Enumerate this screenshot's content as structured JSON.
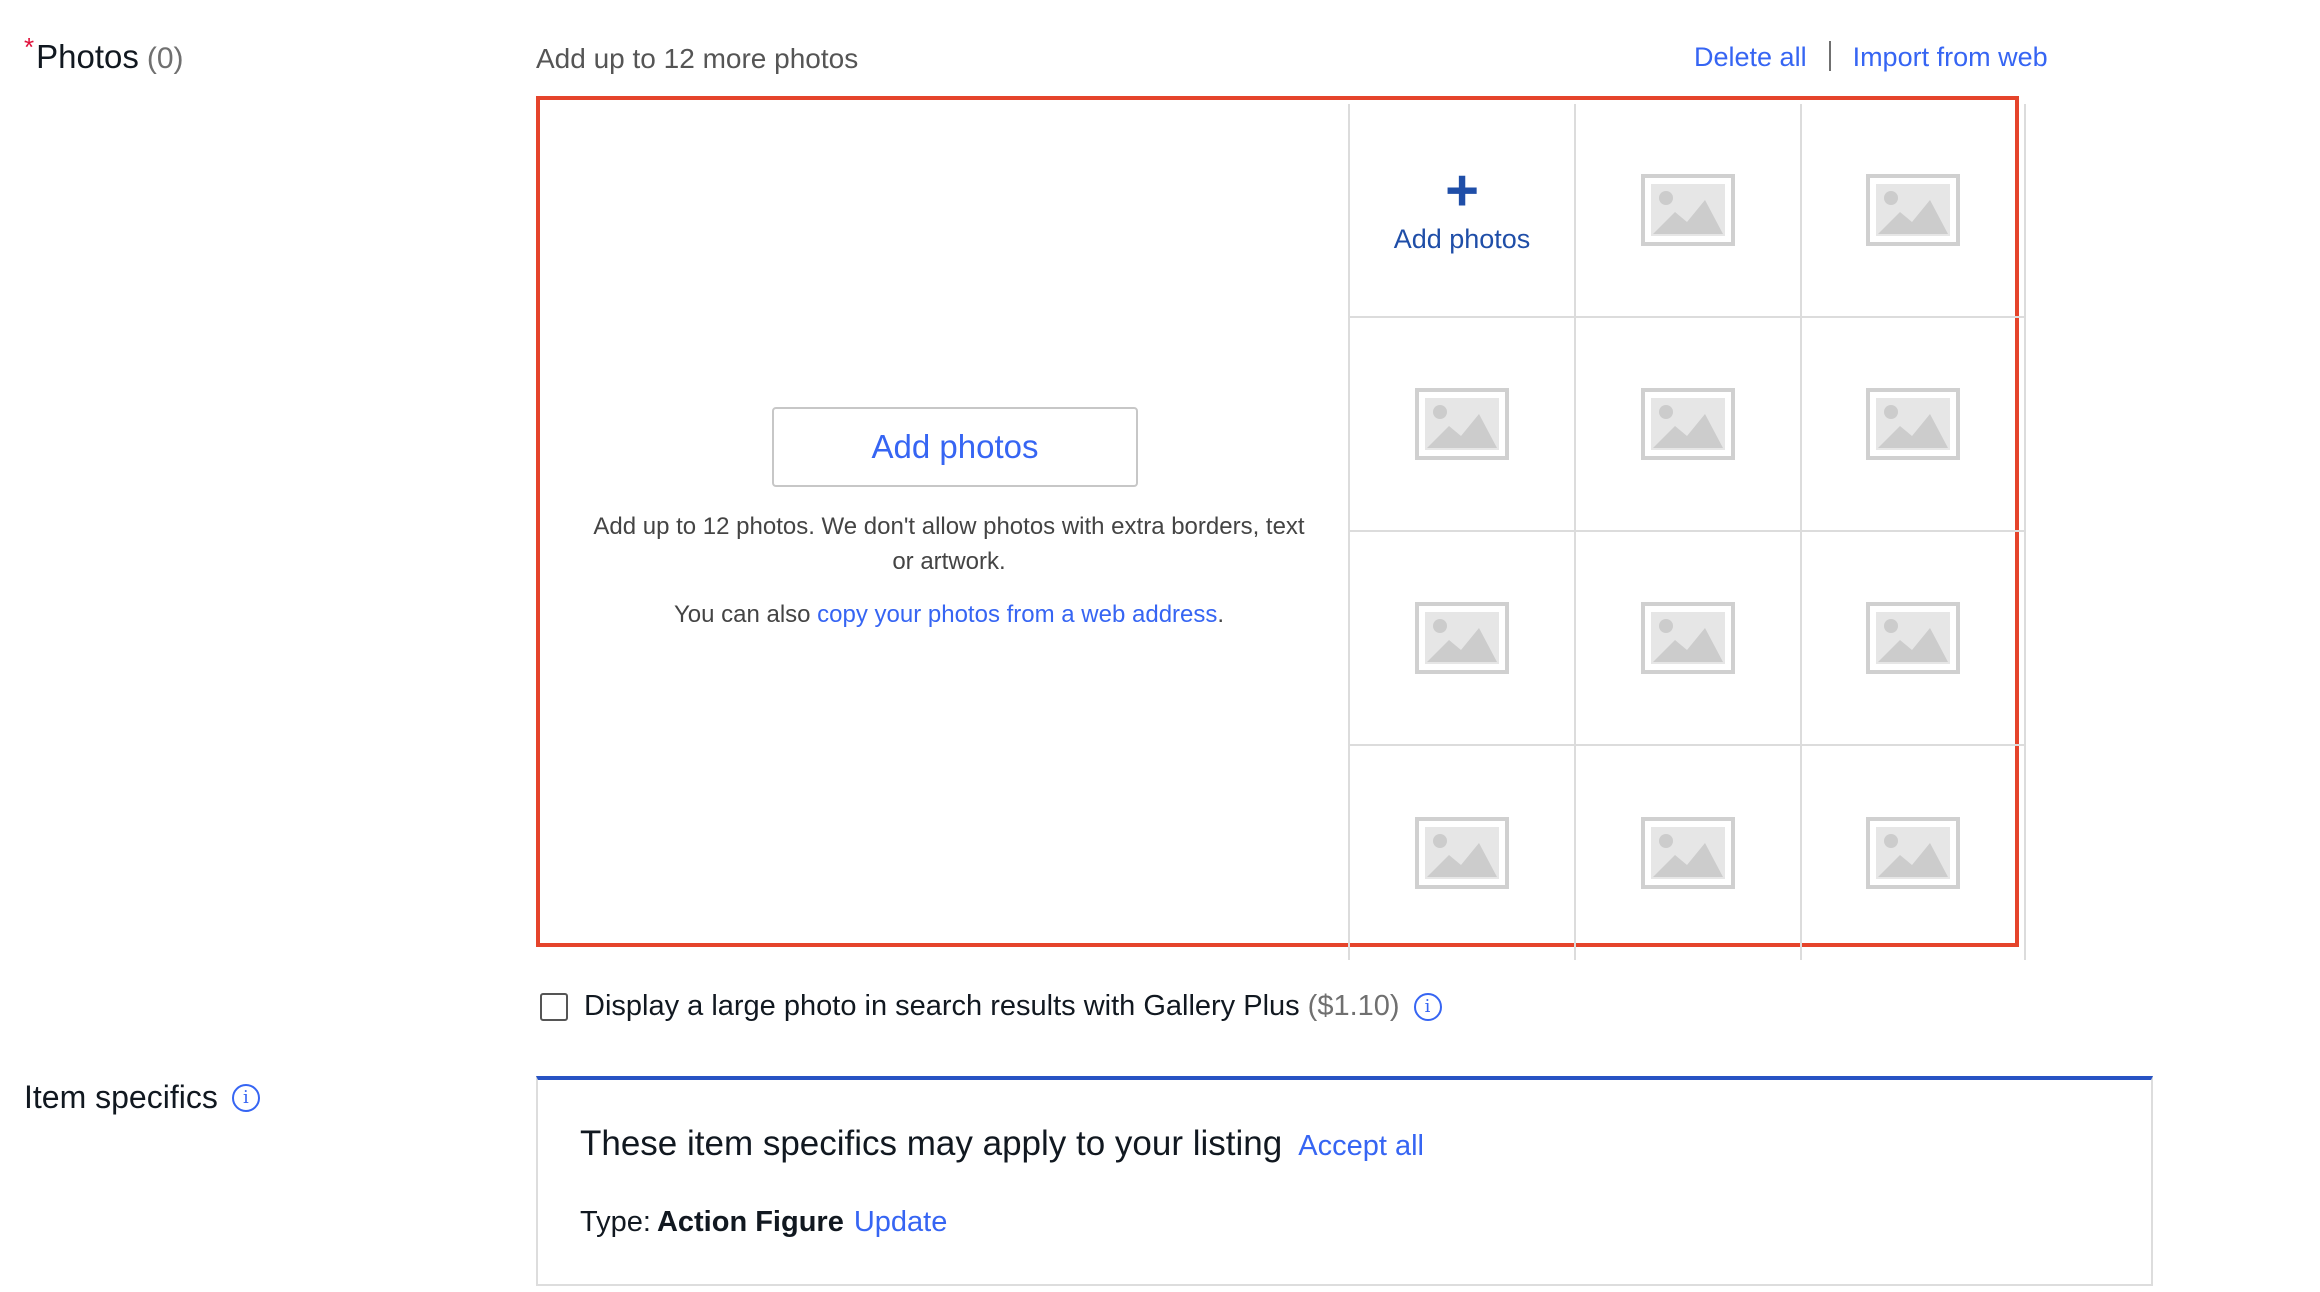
{
  "photos": {
    "required_marker": "*",
    "label": "Photos",
    "count": "(0)",
    "hint": "Add up to 12 more photos",
    "delete_all": "Delete all",
    "import_from_web": "Import from web",
    "add_button_label": "Add photos",
    "instructions": "Add up to 12 photos. We don't allow photos with extra borders, text or artwork.",
    "copy_prefix": "You can also ",
    "copy_link": "copy your photos from a web address",
    "copy_suffix": ".",
    "add_tile_plus": "+",
    "add_tile_label": "Add photos",
    "highlight_color": "#e5442b"
  },
  "gallery_plus": {
    "checked": false,
    "label": "Display a large photo in search results with Gallery Plus",
    "price": "($1.10)",
    "info_icon": "i"
  },
  "item_specifics": {
    "label": "Item specifics",
    "info_icon": "i",
    "card_title": "These item specifics may apply to your listing",
    "accept_all": "Accept all",
    "type_label": "Type:",
    "type_value": "Action Figure",
    "update_link": "Update",
    "accent_color": "#2753c4"
  },
  "colors": {
    "link": "#3665f3",
    "required": "#e0103a"
  }
}
